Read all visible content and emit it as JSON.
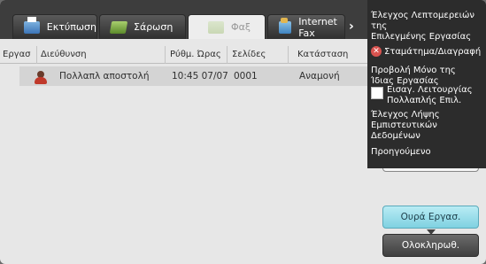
{
  "tabs": [
    {
      "label": "Εκτύπωση",
      "icon": "printer-icon"
    },
    {
      "label": "Σάρωση",
      "icon": "scanner-icon"
    },
    {
      "label": "Φαξ",
      "icon": "fax-icon"
    },
    {
      "label": "Internet Fax",
      "icon": "internet-fax-icon"
    }
  ],
  "table": {
    "headers": [
      "Εργασ",
      "Διεύθυνση",
      "Ρύθμ. Ώρας",
      "Σελίδες",
      "Κατάσταση"
    ],
    "rows": [
      {
        "address": "Πολλαπλ αποστολή",
        "time": "10:45 07/07",
        "pages": "0001",
        "status": "Αναμονή"
      }
    ]
  },
  "menu": {
    "item1_line1": "Έλεγχος Λεπτομερειών της",
    "item1_line2": "Επιλεγμένης Εργασίας",
    "item2": "Σταμάτημα/Διαγραφή",
    "item3_line1": "Προβολή Μόνο της",
    "item3_line2": "Ίδιας Εργασίας",
    "item4_line1": "Εισαγ. Λειτουργίας",
    "item4_line2": "Πολλαπλής Επιλ.",
    "item5_line1": "Έλεγχος Λήψης",
    "item5_line2": "Εμπιστευτικών Δεδομένων",
    "item6": "Προηγούμενο"
  },
  "buttons": {
    "job_queue": "Ουρά Εργασ.",
    "completed": "Ολοκληρωθ."
  }
}
